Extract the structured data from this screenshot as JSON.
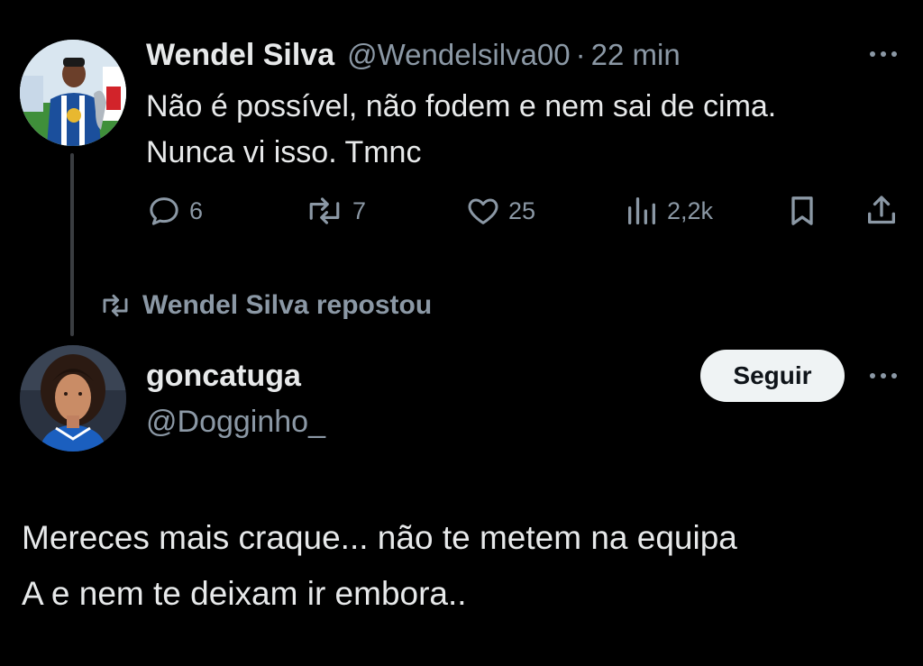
{
  "original_tweet": {
    "author_name": "Wendel Silva",
    "handle": "@Wendelsilva00",
    "separator": "·",
    "time": "22 min",
    "text_line1": "Não é possível, não fodem e nem sai de cima.",
    "text_line2": "Nunca vi isso. Tmnc",
    "actions": {
      "reply_count": "6",
      "repost_count": "7",
      "like_count": "25",
      "views_count": "2,2k"
    },
    "more_icon": "ellipsis-icon"
  },
  "repost_context": {
    "label": "Wendel Silva repostou",
    "icon": "repost-icon"
  },
  "reposted_tweet": {
    "author_name": "goncatuga",
    "handle": "@Dogginho_",
    "follow_label": "Seguir",
    "text_line1": "Mereces mais craque... não te metem na equipa",
    "text_line2": "A e nem te deixam ir embora..",
    "more_icon": "ellipsis-icon"
  },
  "colors": {
    "background": "#000000",
    "primary_text": "#e7e9ea",
    "secondary_text": "#8b98a5",
    "follow_button_bg": "#eff3f4"
  }
}
